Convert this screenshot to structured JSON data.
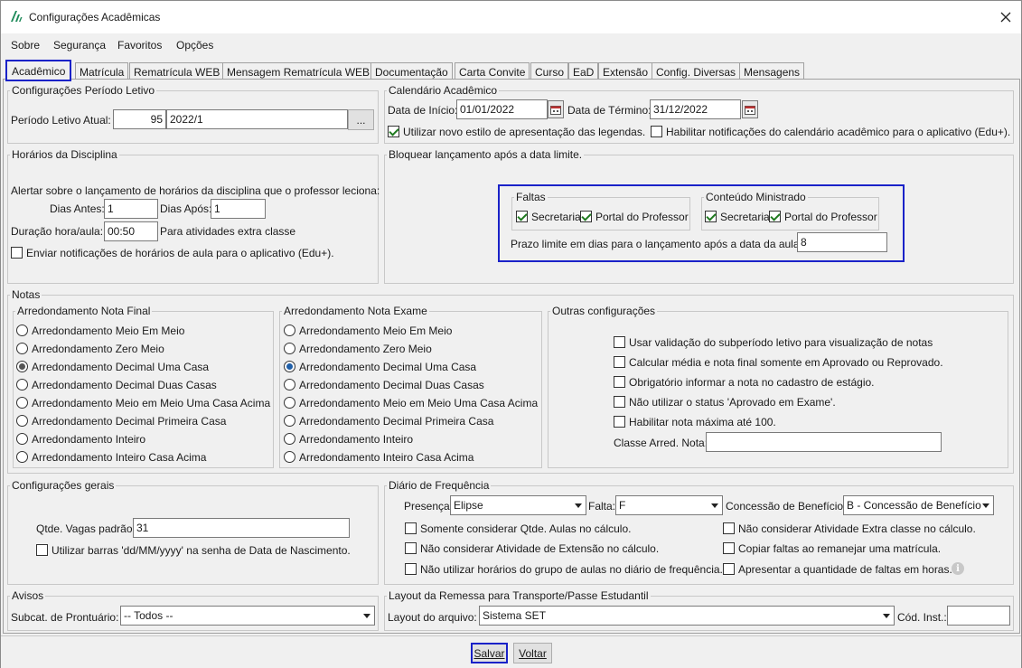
{
  "window": {
    "title": "Configurações Acadêmicas",
    "logo_icon": "app-logo-icon",
    "close_icon": "close-icon"
  },
  "menu": {
    "items": [
      "Sobre",
      "Segurança",
      "Favoritos",
      "Opções"
    ]
  },
  "tabs": [
    "Acadêmico",
    "Matrícula",
    "Rematrícula WEB",
    "Mensagem Rematrícula WEB",
    "Documentação",
    "Carta Convite",
    "Curso",
    "EaD",
    "Extensão",
    "Config. Diversas",
    "Mensagens"
  ],
  "periodo": {
    "legend": "Configurações Período Letivo",
    "label": "Período Letivo Atual:",
    "code": "95",
    "value": "2022/1",
    "browse": "..."
  },
  "calendario": {
    "legend": "Calendário Acadêmico",
    "inicio_label": "Data de Início:",
    "inicio": "01/01/2022",
    "termino_label": "Data de Término:",
    "termino": "31/12/2022",
    "novo_estilo": "Utilizar novo estilo de apresentação das legendas.",
    "notificacoes": "Habilitar notificações do calendário acadêmico para o aplicativo (Edu+)."
  },
  "horarios": {
    "legend": "Horários da Disciplina",
    "alertar": "Alertar sobre o lançamento de horários da disciplina que o professor leciona:",
    "dias_antes_label": "Dias Antes:",
    "dias_antes": "1",
    "dias_apos_label": "Dias Após:",
    "dias_apos": "1",
    "duracao_label": "Duração hora/aula:",
    "duracao": "00:50",
    "extra": "Para atividades extra classe",
    "enviar": "Enviar notificações de horários de aula para o aplicativo (Edu+)."
  },
  "bloquear": {
    "legend": "Bloquear lançamento após a data limite.",
    "faltas_legend": "Faltas",
    "conteudo_legend": "Conteúdo Ministrado",
    "secretaria": "Secretaria",
    "portal": "Portal do Professor",
    "prazo_label": "Prazo limite em dias para o lançamento após a data da aula:",
    "prazo": "8"
  },
  "notas": {
    "legend": "Notas",
    "final_legend": "Arredondamento Nota Final",
    "exame_legend": "Arredondamento Nota Exame",
    "options": [
      "Arredondamento Meio Em Meio",
      "Arredondamento Zero Meio",
      "Arredondamento Decimal Uma Casa",
      "Arredondamento Decimal Duas Casas",
      "Arredondamento Meio em Meio Uma Casa Acima",
      "Arredondamento Decimal Primeira Casa",
      "Arredondamento Inteiro",
      "Arredondamento Inteiro Casa Acima"
    ],
    "outras_legend": "Outras configurações",
    "outras": [
      "Usar validação do subperíodo letivo para visualização de notas",
      "Calcular média e nota final somente em Aprovado ou Reprovado.",
      "Obrigatório informar a nota no cadastro de estágio.",
      "Não utilizar o status 'Aprovado em Exame'.",
      "Habilitar nota máxima até 100."
    ],
    "classe_label": "Classe Arred. Nota:",
    "classe": ""
  },
  "gerais": {
    "legend": "Configurações gerais",
    "vagas_label": "Qtde. Vagas padrão:",
    "vagas": "31",
    "barras": "Utilizar barras 'dd/MM/yyyy' na senha de Data de Nascimento."
  },
  "diario": {
    "legend": "Diário de Frequência",
    "presenca_label": "Presença:",
    "presenca": "Elipse",
    "falta_label": "Falta:",
    "falta": "F",
    "beneficio_label": "Concessão de Benefício:",
    "beneficio": "B - Concessão de Benefício",
    "left": [
      "Somente considerar Qtde. Aulas no cálculo.",
      "Não considerar Atividade de Extensão no cálculo.",
      "Não utilizar horários do grupo de aulas no diário de frequência."
    ],
    "right": [
      "Não considerar Atividade Extra classe no cálculo.",
      "Copiar faltas ao remanejar uma matrícula.",
      "Apresentar a quantidade de faltas em horas."
    ]
  },
  "avisos": {
    "legend": "Avisos",
    "label": "Subcat. de Prontuário:",
    "value": "-- Todos --"
  },
  "layout": {
    "legend": "Layout da Remessa para Transporte/Passe Estudantil",
    "label": "Layout do arquivo:",
    "value": "Sistema SET",
    "cod_label": "Cód. Inst.:",
    "cod": ""
  },
  "footer": {
    "salvar": "Salvar",
    "voltar": "Voltar"
  },
  "colors": {
    "accent": "#1a22c8",
    "check": "#1f7a1f"
  }
}
